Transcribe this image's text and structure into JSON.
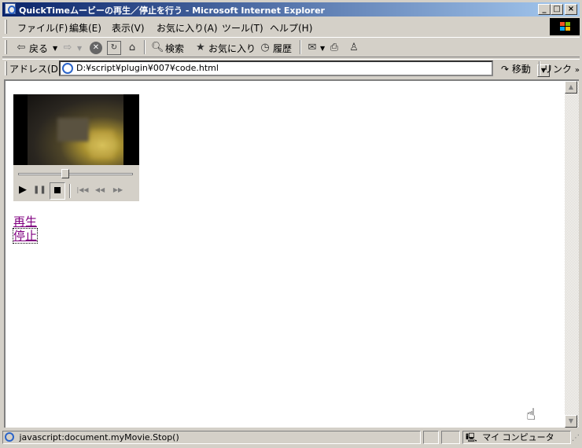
{
  "window": {
    "title": "QuickTimeムービーの再生／停止を行う - Microsoft Internet Explorer",
    "controls": {
      "minimize": "_",
      "maximize": "□",
      "close": "×"
    }
  },
  "menu": {
    "items": [
      "ファイル(F)",
      "編集(E)",
      "表示(V)",
      "お気に入り(A)",
      "ツール(T)",
      "ヘルプ(H)"
    ]
  },
  "toolbar": {
    "back": "戻る",
    "search": "検索",
    "favorites": "お気に入り",
    "history": "履歴"
  },
  "address": {
    "label": "アドレス(D)",
    "value": "D:¥script¥plugin¥007¥code.html",
    "go": "移動",
    "links": "リンク"
  },
  "page": {
    "link_play": "再生",
    "link_stop": "停止"
  },
  "movie": {
    "position_fraction": 0.41,
    "playing": false
  },
  "status": {
    "text": "javascript:document.myMovie.Stop()",
    "zone": "マイ コンピュータ"
  },
  "colors": {
    "titlebar_start": "#0a246a",
    "titlebar_end": "#a6caf0",
    "link_visited": "#800080",
    "chrome": "#d4d0c8"
  }
}
